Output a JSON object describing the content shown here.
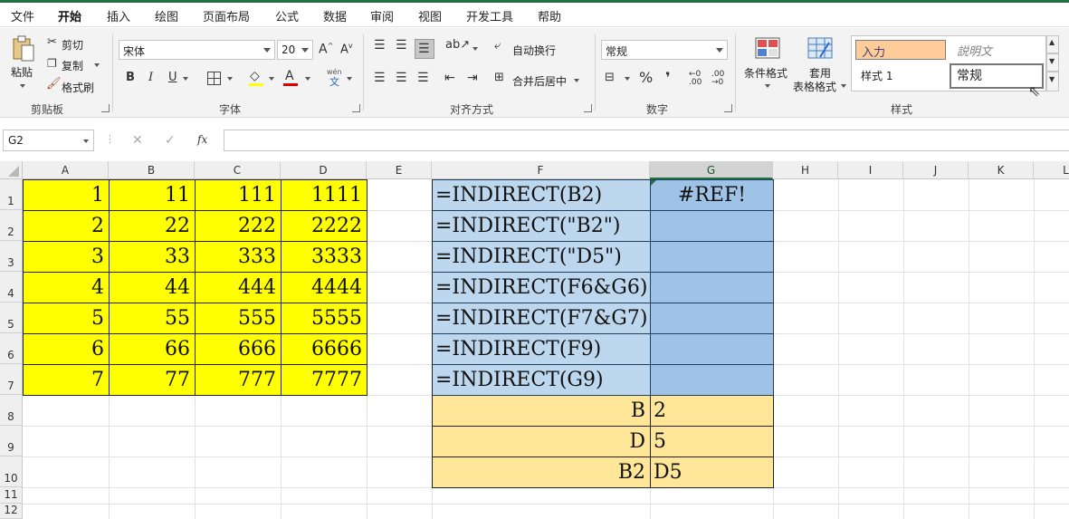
{
  "menu": [
    "文件",
    "开始",
    "插入",
    "绘图",
    "页面布局",
    "公式",
    "数据",
    "审阅",
    "视图",
    "开发工具",
    "帮助"
  ],
  "active_menu": "开始",
  "clipboard": {
    "paste": "粘贴",
    "cut": "剪切",
    "copy": "复制",
    "format_painter": "格式刷",
    "group": "剪贴板"
  },
  "font": {
    "name": "宋体",
    "size": "20",
    "bold": "B",
    "italic": "I",
    "underline": "U",
    "pinyin": "wén",
    "group": "字体"
  },
  "alignment": {
    "wrap": "自动换行",
    "merge": "合并后居中",
    "group": "对齐方式"
  },
  "number": {
    "format": "常规",
    "percent": "%",
    "comma": "❜",
    "group": "数字"
  },
  "styles": {
    "conditional": "条件格式",
    "table_line1": "套用",
    "table_line2": "表格格式",
    "input": "入力",
    "explanatory": "説明文",
    "style1": "样式 1",
    "normal": "常规",
    "group": "样式"
  },
  "namebox": "G2",
  "fx": "fx",
  "columns": [
    "A",
    "B",
    "C",
    "D",
    "E",
    "F",
    "G",
    "H",
    "I",
    "J",
    "K",
    "L"
  ],
  "rows": [
    "1",
    "2",
    "3",
    "4",
    "5",
    "6",
    "7",
    "8",
    "9",
    "10",
    "11",
    "12"
  ],
  "selected_column": "G",
  "yellow_table": [
    [
      "1",
      "11",
      "111",
      "1111"
    ],
    [
      "2",
      "22",
      "222",
      "2222"
    ],
    [
      "3",
      "33",
      "333",
      "3333"
    ],
    [
      "4",
      "44",
      "444",
      "4444"
    ],
    [
      "5",
      "55",
      "555",
      "5555"
    ],
    [
      "6",
      "66",
      "666",
      "6666"
    ],
    [
      "7",
      "77",
      "777",
      "7777"
    ]
  ],
  "formulas": [
    "=INDIRECT(B2)",
    "=INDIRECT(\"B2\")",
    "=INDIRECT(\"D5\")",
    "=INDIRECT(F6&G6)",
    "=INDIRECT(F7&G7)",
    "=INDIRECT(F9)",
    "=INDIRECT(G9)"
  ],
  "results": [
    "#REF!",
    "",
    "",
    "",
    "",
    "",
    ""
  ],
  "lookup": [
    [
      "B",
      "2"
    ],
    [
      "D",
      "5"
    ],
    [
      "B2",
      "D5"
    ]
  ],
  "colors": {
    "accent": "#217346",
    "yellow": "#ffff00",
    "blue": "#bdd7ee",
    "blue_selected": "#9fc3e6",
    "orange": "#ffe699",
    "input_style": "#ffcc99"
  }
}
